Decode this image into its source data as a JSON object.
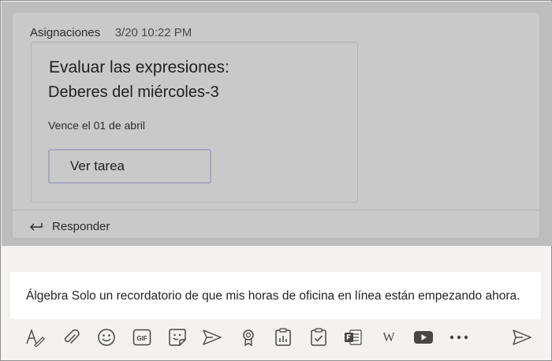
{
  "post": {
    "author": "Asignaciones",
    "timestamp": "3/20 10:22 PM",
    "assignment": {
      "title": "Evaluar las expresiones:",
      "subtitle": "Deberes del miércoles-3",
      "due": "Vence el 01 de abril",
      "button_label": "Ver tarea"
    },
    "reply_label": "Responder"
  },
  "compose": {
    "text": "Álgebra Solo un recordatorio de que mis horas de oficina en línea están empezando ahora."
  },
  "toolbar": {
    "icons": [
      "format-icon",
      "attach-icon",
      "emoji-icon",
      "gif-icon",
      "sticker-icon",
      "meet-icon",
      "praise-icon",
      "insights-icon",
      "assignments-icon",
      "forms-icon",
      "wikipedia-icon",
      "youtube-icon",
      "more-icon",
      "send-icon"
    ],
    "gif_text": "GIF",
    "wikipedia_text": "W"
  }
}
